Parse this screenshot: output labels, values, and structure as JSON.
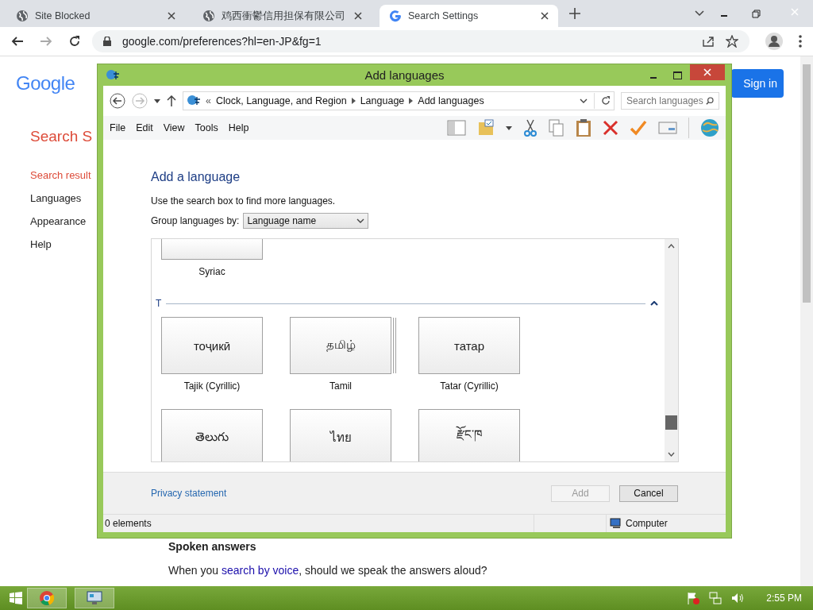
{
  "browser": {
    "tabs": [
      {
        "title": "Site Blocked",
        "selected": false,
        "kind": "globe"
      },
      {
        "title": "鸡西衝鬱信用担保有限公司",
        "selected": false,
        "kind": "globe"
      },
      {
        "title": "Search Settings",
        "selected": true,
        "kind": "google"
      }
    ],
    "url": "google.com/preferences?hl=en-JP&fg=1"
  },
  "page": {
    "logo": "Google",
    "sign_in": "Sign in",
    "heading": "Search S",
    "nav": [
      {
        "label": "Search result",
        "selected": true
      },
      {
        "label": "Languages",
        "selected": false
      },
      {
        "label": "Appearance",
        "selected": false
      },
      {
        "label": "Help",
        "selected": false
      }
    ],
    "section_title": "Spoken answers",
    "section_before": "When you ",
    "section_link": "search by voice",
    "section_after": ", should we speak the answers aloud?"
  },
  "dialog": {
    "title": "Add languages",
    "crumb_prefix": "«",
    "breadcrumb": [
      "Clock, Language, and Region",
      "Language",
      "Add languages"
    ],
    "search": {
      "placeholder": "Search languages"
    },
    "menu": [
      "File",
      "Edit",
      "View",
      "Tools",
      "Help"
    ],
    "heading": "Add a language",
    "instruction": "Use the search box to find more languages.",
    "group_label": "Group languages by:",
    "group_value": "Language name",
    "tiles_above": [
      {
        "name": "Syriac"
      }
    ],
    "group": {
      "letter": "T",
      "expanded": true,
      "tiles": [
        {
          "native": "тоҷикӣ",
          "name": "Tajik (Cyrillic)",
          "stacked": false
        },
        {
          "native": "தமிழ்",
          "name": "Tamil",
          "stacked": true
        },
        {
          "native": "татар",
          "name": "Tatar (Cyrillic)",
          "stacked": false
        },
        {
          "native": "తెలుగు",
          "stacked": false
        },
        {
          "native": "ไทย",
          "stacked": false
        },
        {
          "native": "རྫོང་ཁ",
          "stacked": false
        }
      ]
    },
    "privacy": "Privacy statement",
    "buttons": [
      {
        "label": "Add",
        "disabled": true
      },
      {
        "label": "Cancel",
        "disabled": false
      }
    ],
    "status": "0 elements",
    "location": "Computer"
  },
  "taskbar": {
    "apps": [
      {
        "kind": "chrome"
      },
      {
        "kind": "panel"
      }
    ],
    "clock": "2:55 PM"
  }
}
